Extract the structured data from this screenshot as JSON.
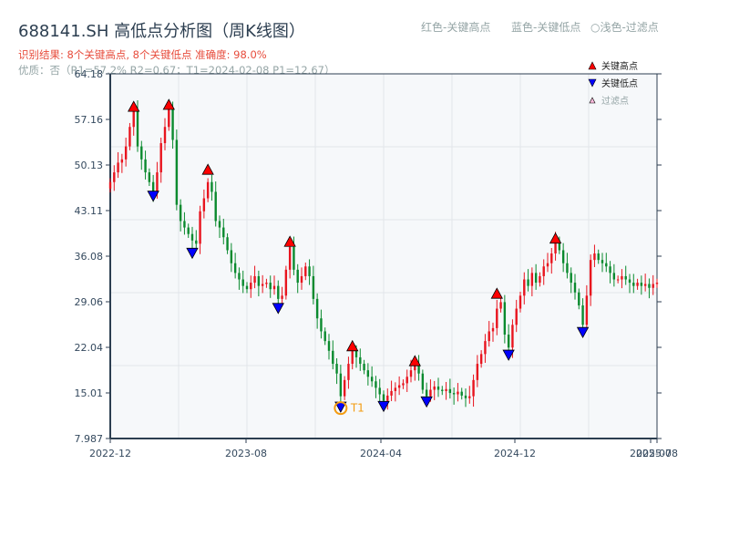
{
  "header": {
    "title": "688141.SH 高低点分析图（周K线图）",
    "result_line": "识别结果: 8个关键高点, 8个关键低点  准确度: 98.0%",
    "quality_line": "优质：否（R1=57.2%  R2=0.67；T1=2024-02-08 P1=12.67）",
    "legend_red": "红色-关键高点",
    "legend_blue": "蓝色-关键低点",
    "legend_light": "○浅色-过滤点"
  },
  "chart_data": {
    "type": "candlestick",
    "title": "688141.SH 高低点分析图（周K线图）",
    "colors": {
      "up": "#e8141e",
      "down": "#0a8a2e",
      "high_marker": "#ff0000",
      "low_marker": "#0000ff",
      "t1_circle": "#f39c12"
    },
    "ylim": [
      7.987,
      64.18
    ],
    "yticks": [
      "64.18",
      "57.16",
      "50.13",
      "43.11",
      "36.08",
      "29.06",
      "22.04",
      "15.01",
      "7.987"
    ],
    "xticks": [
      "2022-12",
      "2023-08",
      "2024-04",
      "2024-12",
      "2025-07",
      "2025-08"
    ],
    "grid": true,
    "legend": {
      "position": "top-right",
      "items": [
        "关键高点",
        "关键低点",
        "过滤点"
      ]
    },
    "weekly_close": [
      47.5,
      49,
      50.5,
      51,
      53,
      56,
      58.5,
      53,
      51,
      49,
      47.5,
      45.8,
      49,
      53.5,
      56,
      58.8,
      54,
      44,
      41.5,
      40.5,
      39.5,
      38.5,
      38,
      43,
      45,
      47.5,
      46,
      41.5,
      40.5,
      39,
      37,
      35,
      33.5,
      32.5,
      31.5,
      31,
      32,
      33,
      31.5,
      31.8,
      32,
      31,
      31.5,
      29.5,
      30,
      34,
      37.5,
      34,
      32,
      33,
      34.5,
      33,
      29.5,
      26.5,
      24.5,
      23,
      21.5,
      19.5,
      18,
      14.5,
      17,
      19.5,
      21.5,
      20.5,
      19.5,
      18.5,
      17.5,
      16.8,
      15.8,
      14.8,
      13.8,
      14.6,
      15.3,
      15.8,
      16.2,
      16.5,
      17.5,
      18.5,
      19.5,
      18,
      15.5,
      14.5,
      15.5,
      16,
      15.5,
      15.3,
      15.6,
      15,
      14.8,
      15.2,
      14.6,
      14.2,
      14.5,
      17,
      19.5,
      21,
      23,
      24.5,
      25,
      28,
      29,
      24,
      22,
      25.5,
      28,
      30,
      32.5,
      31.5,
      33.5,
      32,
      33,
      34.5,
      35,
      36.5,
      38.5,
      37,
      35,
      33.5,
      32,
      30.5,
      28.5,
      25.5,
      30,
      35.5,
      36.5,
      35.5,
      35,
      34.5,
      33.5,
      32.5,
      32.5,
      33,
      32.5,
      32,
      31.5,
      32,
      31.5,
      31.8,
      31.2,
      31.8,
      32
    ],
    "key_highs": [
      {
        "week": 6,
        "price": 59.1
      },
      {
        "week": 15,
        "price": 59.4
      },
      {
        "week": 25,
        "price": 49.4
      },
      {
        "week": 46,
        "price": 38.3
      },
      {
        "week": 62,
        "price": 22.2
      },
      {
        "week": 78,
        "price": 19.9
      },
      {
        "week": 99,
        "price": 30.3
      },
      {
        "week": 114,
        "price": 38.8
      }
    ],
    "key_lows": [
      {
        "week": 11,
        "price": 45.4
      },
      {
        "week": 21,
        "price": 36.6
      },
      {
        "week": 43,
        "price": 28.1
      },
      {
        "week": 59,
        "price": 12.9
      },
      {
        "week": 70,
        "price": 13.0
      },
      {
        "week": 81,
        "price": 13.7
      },
      {
        "week": 102,
        "price": 20.9
      },
      {
        "week": 121,
        "price": 24.4
      }
    ],
    "t1": {
      "label": "T1",
      "week": 59,
      "price": 12.67
    }
  }
}
